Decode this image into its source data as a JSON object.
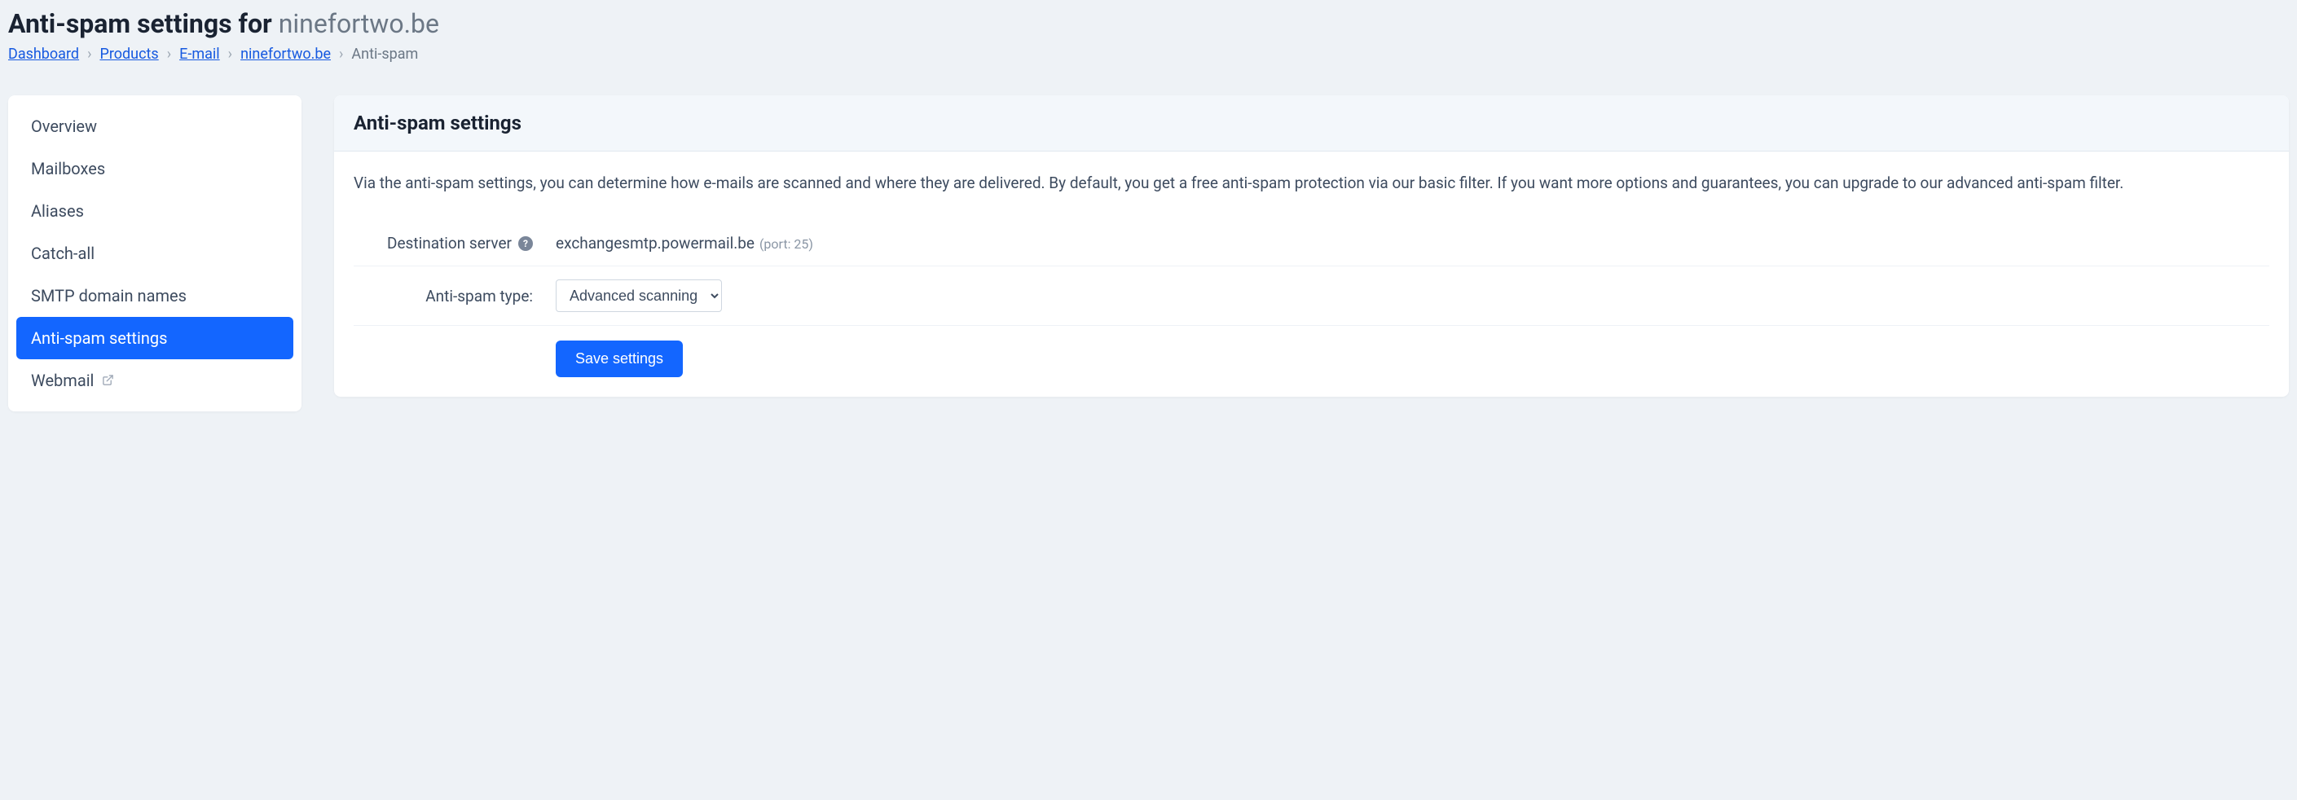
{
  "page": {
    "title_prefix": "Anti-spam settings for ",
    "title_domain": "ninefortwo.be"
  },
  "breadcrumb": {
    "items": [
      {
        "label": "Dashboard",
        "link": true
      },
      {
        "label": "Products",
        "link": true
      },
      {
        "label": "E-mail",
        "link": true
      },
      {
        "label": "ninefortwo.be",
        "link": true
      }
    ],
    "current": "Anti-spam"
  },
  "sidebar": {
    "items": [
      {
        "label": "Overview",
        "name": "sidebar-item-overview",
        "active": false,
        "external": false
      },
      {
        "label": "Mailboxes",
        "name": "sidebar-item-mailboxes",
        "active": false,
        "external": false
      },
      {
        "label": "Aliases",
        "name": "sidebar-item-aliases",
        "active": false,
        "external": false
      },
      {
        "label": "Catch-all",
        "name": "sidebar-item-catchall",
        "active": false,
        "external": false
      },
      {
        "label": "SMTP domain names",
        "name": "sidebar-item-smtp",
        "active": false,
        "external": false
      },
      {
        "label": "Anti-spam settings",
        "name": "sidebar-item-antispam",
        "active": true,
        "external": false
      },
      {
        "label": "Webmail",
        "name": "sidebar-item-webmail",
        "active": false,
        "external": true
      }
    ]
  },
  "panel": {
    "title": "Anti-spam settings",
    "description": "Via the anti-spam settings, you can determine how e-mails are scanned and where they are delivered. By default, you get a free anti-spam protection via our basic filter. If you want more options and guarantees, you can upgrade to our advanced anti-spam filter.",
    "dest_label": "Destination server",
    "dest_value": "exchangesmtp.powermail.be",
    "dest_port": "(port: 25)",
    "type_label": "Anti-spam type:",
    "type_value": "Advanced scanning",
    "save_label": "Save settings"
  }
}
